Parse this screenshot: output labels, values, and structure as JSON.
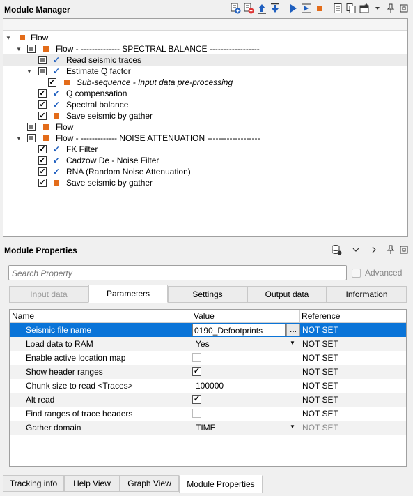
{
  "module_manager": {
    "title": "Module Manager",
    "tree": [
      {
        "label": "Flow"
      },
      {
        "label": "Flow - -------------- SPECTRAL BALANCE ------------------"
      },
      {
        "label": "Read seismic traces"
      },
      {
        "label": "Estimate Q factor"
      },
      {
        "label": "Sub-sequence - Input data pre-processing"
      },
      {
        "label": "Q compensation"
      },
      {
        "label": "Spectral balance"
      },
      {
        "label": "Save seismic by gather"
      },
      {
        "label": "Flow"
      },
      {
        "label": "Flow - ------------- NOISE ATTENUATION -------------------"
      },
      {
        "label": "FK Filter"
      },
      {
        "label": "Cadzow De - Noise Filter"
      },
      {
        "label": "RNA (Random Noise Attenuation)"
      },
      {
        "label": "Save seismic by gather"
      }
    ]
  },
  "module_properties": {
    "title": "Module Properties",
    "search_placeholder": "Search Property",
    "advanced_label": "Advanced",
    "tabs": [
      "Input data",
      "Parameters",
      "Settings",
      "Output data",
      "Information"
    ],
    "active_tab": "Parameters",
    "columns": [
      "Name",
      "Value",
      "Reference"
    ],
    "rows": [
      {
        "name": "Seismic file name",
        "value": "0190_Defootprints",
        "reference": "NOT SET"
      },
      {
        "name": "Load data to RAM",
        "value": "Yes",
        "reference": "NOT SET"
      },
      {
        "name": "Enable active location map",
        "value": "",
        "reference": "NOT SET"
      },
      {
        "name": "Show header ranges",
        "value": "",
        "reference": "NOT SET"
      },
      {
        "name": "Chunk size to read <Traces>",
        "value": "100000",
        "reference": "NOT SET"
      },
      {
        "name": "Alt read",
        "value": "",
        "reference": "NOT SET"
      },
      {
        "name": "Find ranges of trace headers",
        "value": "",
        "reference": "NOT SET"
      },
      {
        "name": "Gather domain",
        "value": "TIME",
        "reference": "NOT SET"
      }
    ],
    "browse_label": "..."
  },
  "bottom_tabs": [
    "Tracking info",
    "Help View",
    "Graph View",
    "Module Properties"
  ],
  "active_bottom_tab": "Module Properties",
  "colors": {
    "accent": "#0a74d8",
    "orange": "#e36c1a",
    "check_blue": "#1f5fbf"
  }
}
